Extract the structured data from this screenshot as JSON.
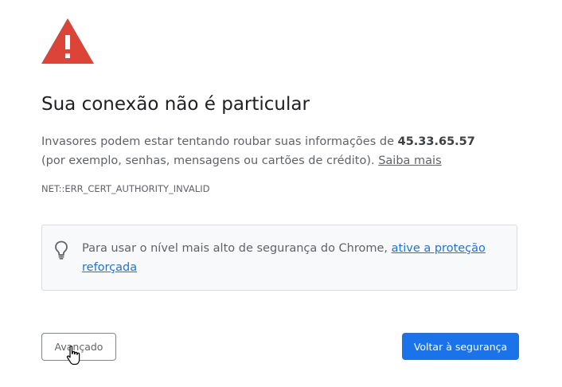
{
  "icons": {
    "warning": "warning-triangle-icon",
    "tip": "lightbulb-icon",
    "cursor": "hand-pointer-icon"
  },
  "colors": {
    "warning_red": "#db4437",
    "primary_blue": "#1a73e8",
    "text_secondary": "#5f6368"
  },
  "heading": "Sua conexão não é particular",
  "description": {
    "prefix": "Invasores podem estar tentando roubar suas informações de ",
    "host": "45.33.65.57",
    "suffix": " (por exemplo, senhas, mensagens ou cartões de crédito). ",
    "learn_more": "Saiba mais"
  },
  "error_code": "NET::ERR_CERT_AUTHORITY_INVALID",
  "tip": {
    "text": "Para usar o nível mais alto de segurança do Chrome, ",
    "link": "ative a proteção reforçada"
  },
  "buttons": {
    "advanced": "Avançado",
    "back_to_safety": "Voltar à segurança"
  }
}
